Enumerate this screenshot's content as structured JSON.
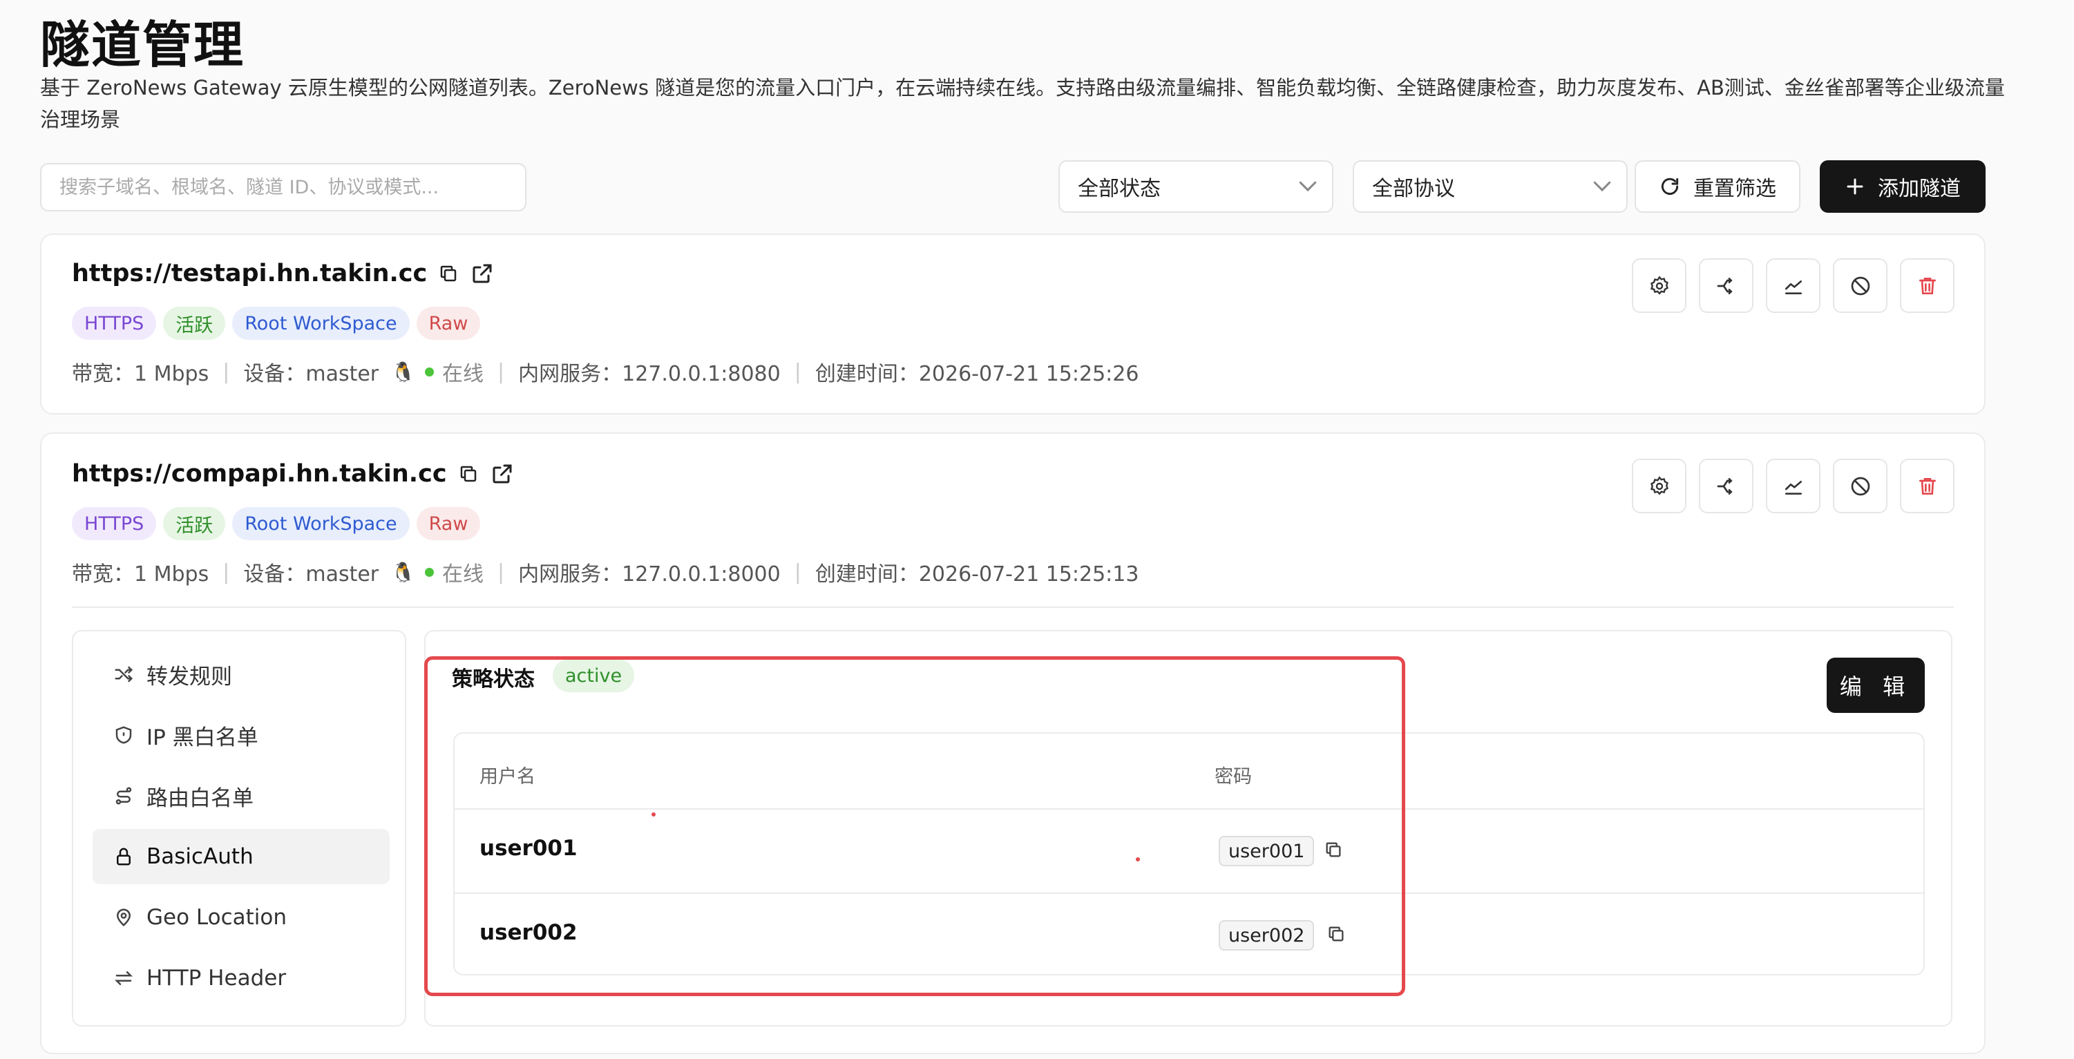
{
  "page": {
    "title": "隧道管理",
    "description": "基于 ZeroNews Gateway 云原生模型的公网隧道列表。ZeroNews 隧道是您的流量入口门户，在云端持续在线。支持路由级流量编排、智能负载均衡、全链路健康检查，助力灰度发布、AB测试、金丝雀部署等企业级流量治理场景"
  },
  "toolbar": {
    "search_placeholder": "搜索子域名、根域名、隧道 ID、协议或模式...",
    "status_select": "全部状态",
    "protocol_select": "全部协议",
    "reset_label": "重置筛选",
    "add_label": "添加隧道"
  },
  "tunnels": [
    {
      "url": "https://testapi.hn.takin.cc",
      "tags": [
        "HTTPS",
        "活跃",
        "Root WorkSpace",
        "Raw"
      ],
      "bandwidth": "带宽：1 Mbps",
      "device": "设备：master",
      "online": "在线",
      "service": "内网服务：127.0.0.1:8080",
      "created": "创建时间：2026-07-21 15:25:26"
    },
    {
      "url": "https://compapi.hn.takin.cc",
      "tags": [
        "HTTPS",
        "活跃",
        "Root WorkSpace",
        "Raw"
      ],
      "bandwidth": "带宽：1 Mbps",
      "device": "设备：master",
      "online": "在线",
      "service": "内网服务：127.0.0.1:8000",
      "created": "创建时间：2026-07-21 15:25:13"
    }
  ],
  "menu": {
    "items": [
      {
        "label": "转发规则",
        "icon": "shuffle-icon"
      },
      {
        "label": "IP 黑白名单",
        "icon": "shield-icon"
      },
      {
        "label": "路由白名单",
        "icon": "route-icon"
      },
      {
        "label": "BasicAuth",
        "icon": "lock-icon",
        "active": true
      },
      {
        "label": "Geo Location",
        "icon": "location-pin-icon"
      },
      {
        "label": "HTTP Header",
        "icon": "swap-arrows-icon"
      }
    ]
  },
  "basicauth": {
    "status_label": "策略状态",
    "status_value": "active",
    "edit_label": "编 辑",
    "columns": [
      "用户名",
      "密码"
    ],
    "rows": [
      {
        "username": "user001",
        "password": "user001"
      },
      {
        "username": "user002",
        "password": "user002"
      }
    ]
  },
  "colors": {
    "accent_dark": "#161616",
    "highlight_box": "#e5484d",
    "online_dot": "#4bc43a",
    "delete_red": "#e5484d"
  }
}
